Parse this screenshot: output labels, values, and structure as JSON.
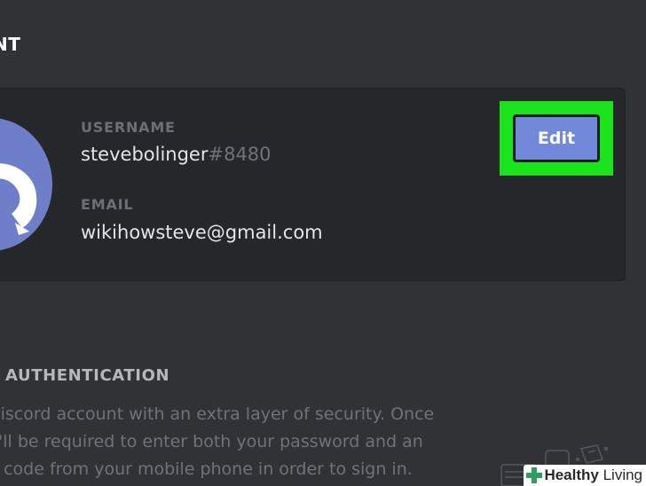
{
  "account": {
    "section_title": "NT",
    "username_label": "USERNAME",
    "username": "stevebolinger",
    "discriminator": "#8480",
    "email_label": "EMAIL",
    "email": "wikihowsteve@gmail.com",
    "edit_label": "Edit"
  },
  "two_factor": {
    "title": "AUTHENTICATION",
    "description_lines": [
      "Discord account with an extra layer of security. Once",
      "u'll be required to enter both your password and an",
      "n code from your mobile phone in order to sign in."
    ]
  },
  "watermark": {
    "bold": "Healthy",
    "regular": " Living"
  },
  "colors": {
    "background": "#303236",
    "card": "#25272b",
    "accent": "#7289da",
    "highlight": "#1be31b",
    "watermark_plus": "#2e9e5e"
  },
  "icons": {
    "avatar": "discord-logo-icon",
    "watermark": "medical-plus-icon"
  }
}
